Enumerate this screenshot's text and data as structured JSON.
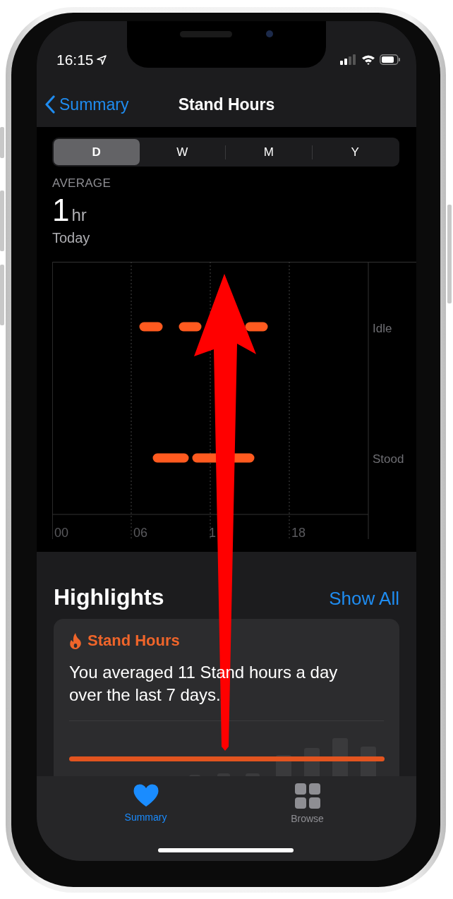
{
  "status_bar": {
    "time": "16:15"
  },
  "nav": {
    "back": "Summary",
    "title": "Stand Hours"
  },
  "segments": [
    {
      "label": "D",
      "selected": true
    },
    {
      "label": "W",
      "selected": false
    },
    {
      "label": "M",
      "selected": false
    },
    {
      "label": "Y",
      "selected": false
    }
  ],
  "summary": {
    "label": "AVERAGE",
    "value": "1",
    "unit": "hr",
    "period": "Today"
  },
  "chart": {
    "row_labels": [
      "Idle",
      "Stood"
    ],
    "x_labels": [
      "00",
      "06",
      "1",
      "18"
    ]
  },
  "highlights": {
    "title": "Highlights",
    "action": "Show All",
    "card": {
      "title": "Stand Hours",
      "text": "You averaged 11 Stand hours a day over the last 7 days."
    }
  },
  "tab_bar": [
    {
      "label": "Summary",
      "kind": "heart",
      "selected": true
    },
    {
      "label": "Browse",
      "kind": "grid",
      "selected": false
    }
  ]
}
